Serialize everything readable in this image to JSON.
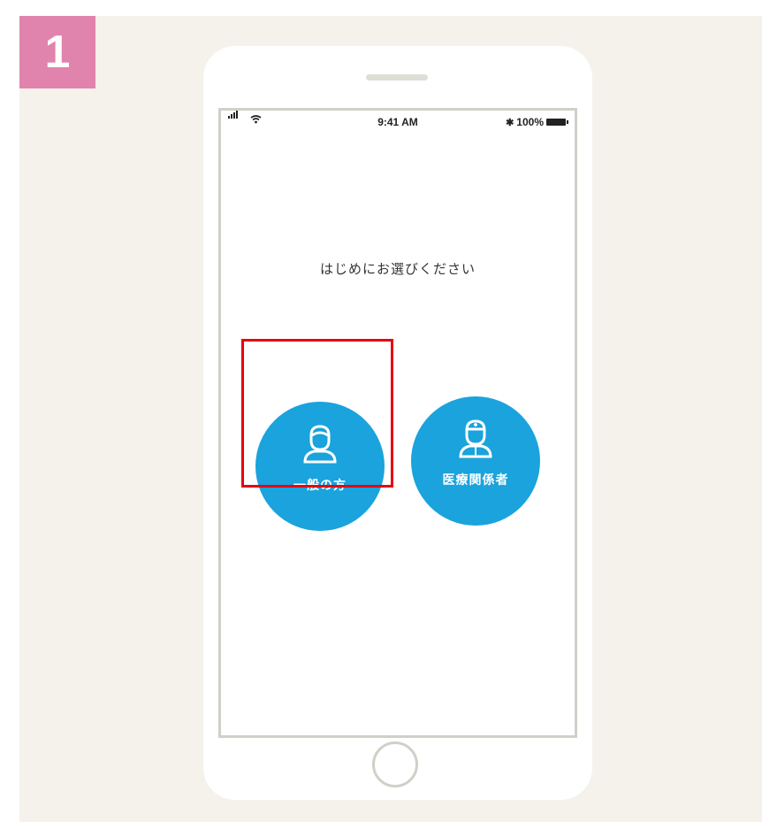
{
  "step": {
    "number": "1"
  },
  "status_bar": {
    "time": "9:41 AM",
    "battery": "100%"
  },
  "screen": {
    "prompt": "はじめにお選びください",
    "options": [
      {
        "label": "一般の方",
        "icon": "person-icon",
        "highlighted": true
      },
      {
        "label": "医療関係者",
        "icon": "medical-staff-icon",
        "highlighted": false
      }
    ]
  },
  "colors": {
    "badge": "#e083ad",
    "button": "#1aa3dc",
    "highlight": "#e60012",
    "panel": "#f5f2ec"
  }
}
